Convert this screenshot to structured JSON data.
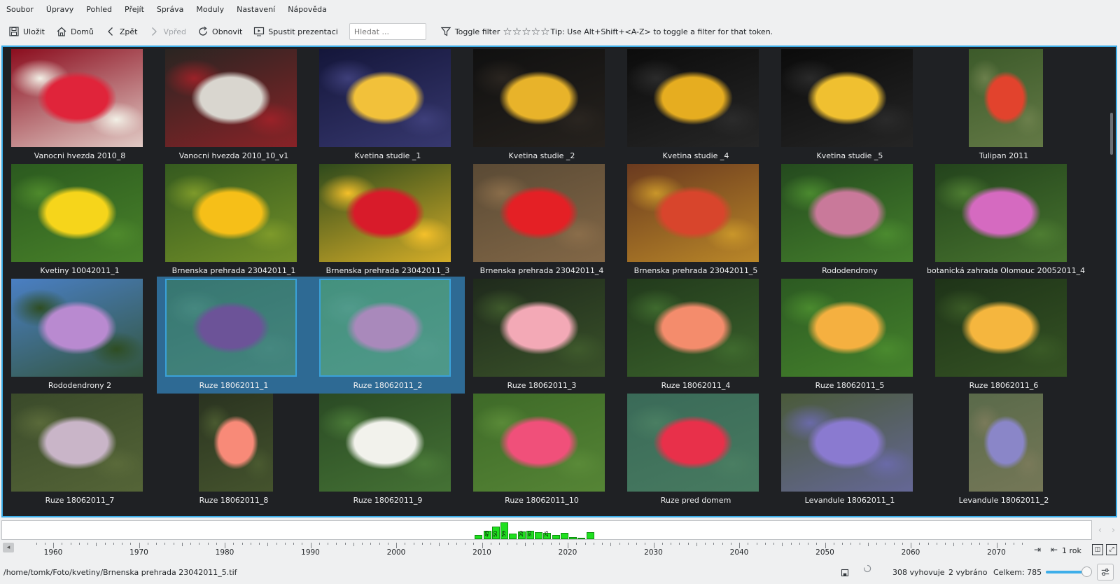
{
  "menu": [
    "Soubor",
    "Úpravy",
    "Pohled",
    "Přejít",
    "Správa",
    "Moduly",
    "Nastavení",
    "Nápověda"
  ],
  "toolbar": {
    "save": "Uložit",
    "home": "Domů",
    "back": "Zpět",
    "forward": "Vpřed",
    "refresh": "Obnovit",
    "slideshow": "Spustit prezentaci",
    "search_placeholder": "Hledat ...",
    "toggle_filter": "Toggle filter",
    "stars": [
      "☆",
      "☆",
      "☆",
      "☆",
      "☆"
    ],
    "tip": "Tip: Use Alt+Shift+<A-Z> to toggle a filter for that token."
  },
  "thumbnails": [
    {
      "caption": "Vanocni hvezda 2010_8",
      "orientation": "l",
      "colors": [
        "#8b0d1e",
        "#e0243a",
        "#f2f0e6"
      ],
      "selected": false
    },
    {
      "caption": "Vanocni hvezda 2010_10_v1",
      "orientation": "l",
      "colors": [
        "#2a2522",
        "#d9d6cf",
        "#9b2228"
      ],
      "selected": false
    },
    {
      "caption": "Kvetina studie _1",
      "orientation": "l",
      "colors": [
        "#14163a",
        "#f2c13a",
        "#3e3f7a"
      ],
      "selected": false
    },
    {
      "caption": "Kvetina studie _2",
      "orientation": "l",
      "colors": [
        "#101010",
        "#e8b32a",
        "#2a2520"
      ],
      "selected": false
    },
    {
      "caption": "Kvetina studie _4",
      "orientation": "l",
      "colors": [
        "#0c0c0c",
        "#e6ad20",
        "#2b2b2b"
      ],
      "selected": false
    },
    {
      "caption": "Kvetina studie _5",
      "orientation": "l",
      "colors": [
        "#0b0b0b",
        "#f0c030",
        "#2a2a2a"
      ],
      "selected": false
    },
    {
      "caption": "Tulipan 2011",
      "orientation": "p",
      "colors": [
        "#3c5a2a",
        "#e2432d",
        "#6b7f4b"
      ],
      "selected": false
    },
    {
      "caption": "Kvetiny 10042011_1",
      "orientation": "l",
      "colors": [
        "#2b5a1f",
        "#f6d51b",
        "#4f8a2c"
      ],
      "selected": false
    },
    {
      "caption": "Brnenska prehrada 23042011_1",
      "orientation": "l",
      "colors": [
        "#355a1f",
        "#f6bf18",
        "#7e9a2a"
      ],
      "selected": false
    },
    {
      "caption": "Brnenska prehrada 23042011_3",
      "orientation": "l",
      "colors": [
        "#2e4a1c",
        "#d81b2a",
        "#f4c02a"
      ],
      "selected": false
    },
    {
      "caption": "Brnenska prehrada 23042011_4",
      "orientation": "l",
      "colors": [
        "#5a4a35",
        "#e42025",
        "#8a6d4a"
      ],
      "selected": false
    },
    {
      "caption": "Brnenska prehrada 23042011_5",
      "orientation": "l",
      "colors": [
        "#6a3a1f",
        "#d8452c",
        "#c9962a"
      ],
      "selected": false
    },
    {
      "caption": "Rododendrony",
      "orientation": "l",
      "colors": [
        "#244a1e",
        "#c9799a",
        "#4b8a2f"
      ],
      "selected": false
    },
    {
      "caption": "botanická zahrada Olomouc 20052011_4",
      "orientation": "l",
      "colors": [
        "#23431c",
        "#d56ac0",
        "#4e7d32"
      ],
      "selected": false
    },
    {
      "caption": "Rododendrony 2",
      "orientation": "l",
      "colors": [
        "#4a7fc4",
        "#b98ad0",
        "#2e4d22"
      ],
      "selected": false
    },
    {
      "caption": "Ruze  18062011_1",
      "orientation": "l",
      "colors": [
        "#3a7a6a",
        "#7a4e9a",
        "#4c8f7c"
      ],
      "selected": true
    },
    {
      "caption": "Ruze  18062011_2",
      "orientation": "l",
      "colors": [
        "#4a9a7a",
        "#c491c4",
        "#5aa68a"
      ],
      "selected": true
    },
    {
      "caption": "Ruze  18062011_3",
      "orientation": "l",
      "colors": [
        "#1f2a1c",
        "#f3a9b6",
        "#3f5a2c"
      ],
      "selected": false
    },
    {
      "caption": "Ruze  18062011_4",
      "orientation": "l",
      "colors": [
        "#223a1c",
        "#f48c6c",
        "#3f6a2e"
      ],
      "selected": false
    },
    {
      "caption": "Ruze  18062011_5",
      "orientation": "l",
      "colors": [
        "#2c5a22",
        "#f5b040",
        "#4a8a2e"
      ],
      "selected": false
    },
    {
      "caption": "Ruze  18062011_6",
      "orientation": "l",
      "colors": [
        "#1e3318",
        "#f5b63e",
        "#3a5a26"
      ],
      "selected": false
    },
    {
      "caption": "Ruze  18062011_7",
      "orientation": "l",
      "colors": [
        "#3a4a2a",
        "#c9b5c8",
        "#5a6a3a"
      ],
      "selected": false
    },
    {
      "caption": "Ruze  18062011_8",
      "orientation": "p",
      "colors": [
        "#2a3320",
        "#f88a78",
        "#4a5a30"
      ],
      "selected": false
    },
    {
      "caption": "Ruze  18062011_9",
      "orientation": "l",
      "colors": [
        "#2a4a24",
        "#f2f2ec",
        "#4a7a38"
      ],
      "selected": false
    },
    {
      "caption": "Ruze  18062011_10",
      "orientation": "l",
      "colors": [
        "#3e6a28",
        "#f0507a",
        "#5a8a38"
      ],
      "selected": false
    },
    {
      "caption": "Ruze pred domem",
      "orientation": "l",
      "colors": [
        "#3a6a58",
        "#e8304a",
        "#4a7e62"
      ],
      "selected": false
    },
    {
      "caption": "Levandule  18062011_1",
      "orientation": "l",
      "colors": [
        "#4a5a3a",
        "#8a7ad0",
        "#6a6aa8"
      ],
      "selected": false
    },
    {
      "caption": "Levandule  18062011_2",
      "orientation": "p",
      "colors": [
        "#5a6a4a",
        "#8a86c8",
        "#7a7a5a"
      ],
      "selected": false
    }
  ],
  "timeline": {
    "years": [
      "1960",
      "1970",
      "1980",
      "1990",
      "2000",
      "2010",
      "2020",
      "2030",
      "2040",
      "2050",
      "2060",
      "2070"
    ],
    "range_label": "1 rok",
    "bars": [
      {
        "year": 2009.1,
        "count": 8,
        "label": ""
      },
      {
        "year": 2010.1,
        "count": 15,
        "label": "49"
      },
      {
        "year": 2011.1,
        "count": 22,
        "label": "50"
      },
      {
        "year": 2012.1,
        "count": 30,
        "label": "59"
      },
      {
        "year": 2013.1,
        "count": 10,
        "label": ""
      },
      {
        "year": 2014.1,
        "count": 14,
        "label": "39"
      },
      {
        "year": 2015.1,
        "count": 15,
        "label": "30"
      },
      {
        "year": 2016.1,
        "count": 12,
        "label": ""
      },
      {
        "year": 2017.1,
        "count": 11,
        "label": "25"
      },
      {
        "year": 2018.1,
        "count": 7,
        "label": ""
      },
      {
        "year": 2019.1,
        "count": 11,
        "label": ""
      },
      {
        "year": 2020.1,
        "count": 4,
        "label": ""
      },
      {
        "year": 2021.1,
        "count": 3,
        "label": ""
      },
      {
        "year": 2022.1,
        "count": 12,
        "label": ""
      }
    ]
  },
  "status": {
    "path": "/home/tomk/Foto/kvetiny/Brnenska prehrada 23042011_5.tif",
    "matching": "308 vyhovuje",
    "selected": "2 vybráno",
    "total": "Celkem: 785"
  }
}
